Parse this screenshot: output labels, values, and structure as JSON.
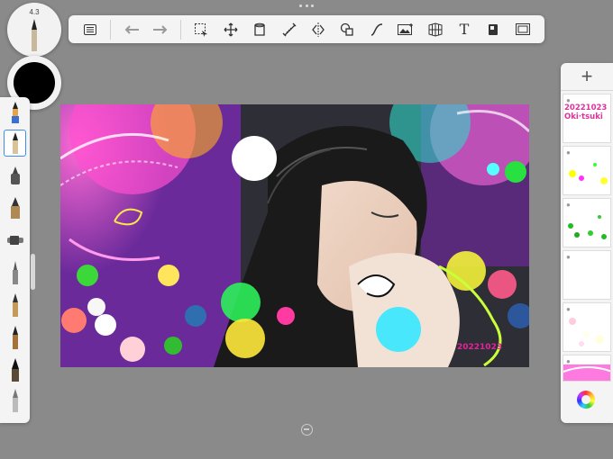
{
  "brush": {
    "size": "4.3",
    "color": "#000000"
  },
  "toolbar": {
    "tools": [
      {
        "name": "list-icon"
      },
      {
        "name": "undo-icon"
      },
      {
        "name": "redo-icon"
      },
      {
        "name": "selection-icon"
      },
      {
        "name": "transform-icon"
      },
      {
        "name": "fill-icon"
      },
      {
        "name": "ruler-icon"
      },
      {
        "name": "symmetry-icon"
      },
      {
        "name": "shape-icon"
      },
      {
        "name": "curve-icon"
      },
      {
        "name": "image-icon"
      },
      {
        "name": "perspective-icon"
      },
      {
        "name": "text-icon"
      },
      {
        "name": "flipbook-icon"
      },
      {
        "name": "fullscreen-icon"
      }
    ],
    "text_tool_glyph": "T"
  },
  "brush_panel": {
    "brushes": [
      "pen-2b",
      "pencil",
      "inking-pen",
      "airbrush",
      "marker",
      "ballpoint",
      "brush-pen",
      "fine-liner",
      "chisel-marker",
      "flat-brush",
      "blender"
    ]
  },
  "layers": {
    "add_label": "+",
    "items": [
      {
        "name": "layer-signature",
        "text": "20221023\nOki Tsuki Ri"
      },
      {
        "name": "layer-dots"
      },
      {
        "name": "layer-green-dots"
      },
      {
        "name": "layer-empty"
      },
      {
        "name": "layer-pastel"
      },
      {
        "name": "layer-pink"
      }
    ]
  },
  "canvas": {
    "signature_top": "20221023",
    "signature_bottom": "20221023"
  },
  "colors": {
    "accent": "#3d8bf5",
    "background": "#8a8a8a",
    "panel": "#f4f4f4"
  }
}
